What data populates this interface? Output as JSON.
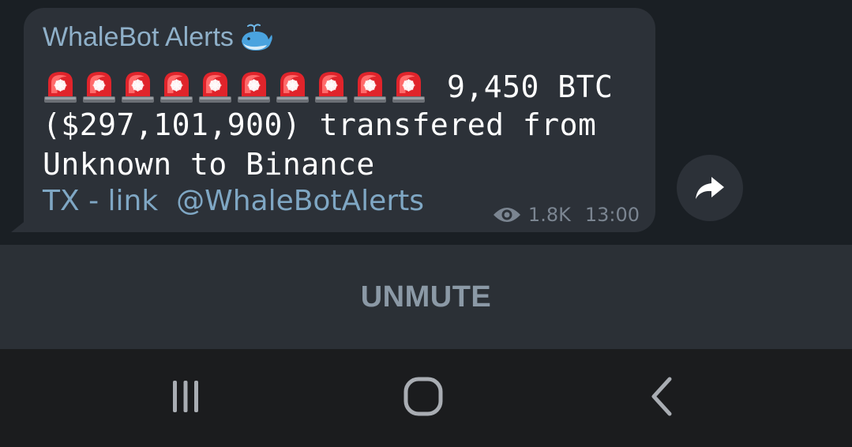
{
  "message": {
    "sender": "WhaleBot Alerts",
    "sender_icon": "whale-icon",
    "siren_icon": "police-siren-icon",
    "siren_count": 10,
    "line1": "9,450 BTC",
    "line2": "($297,101,900) transfered from",
    "line3": "Unknown to Binance",
    "tx_link": "TX - link",
    "channel_link": "@WhaleBotAlerts",
    "views": "1.8K",
    "time": "13:00"
  },
  "unmute_label": "UNMUTE",
  "colors": {
    "chat_background": "#1a1f24",
    "bubble": "#2c3138",
    "sender_name": "#8fb0c9",
    "link": "#7fa7c4",
    "unmute_bar": "#2b3036",
    "unmute_text": "#8b99a6",
    "nav_bar": "#1b1c1e"
  },
  "nav": {
    "recents_icon": "recents-icon",
    "home_icon": "home-icon",
    "back_icon": "back-icon"
  }
}
